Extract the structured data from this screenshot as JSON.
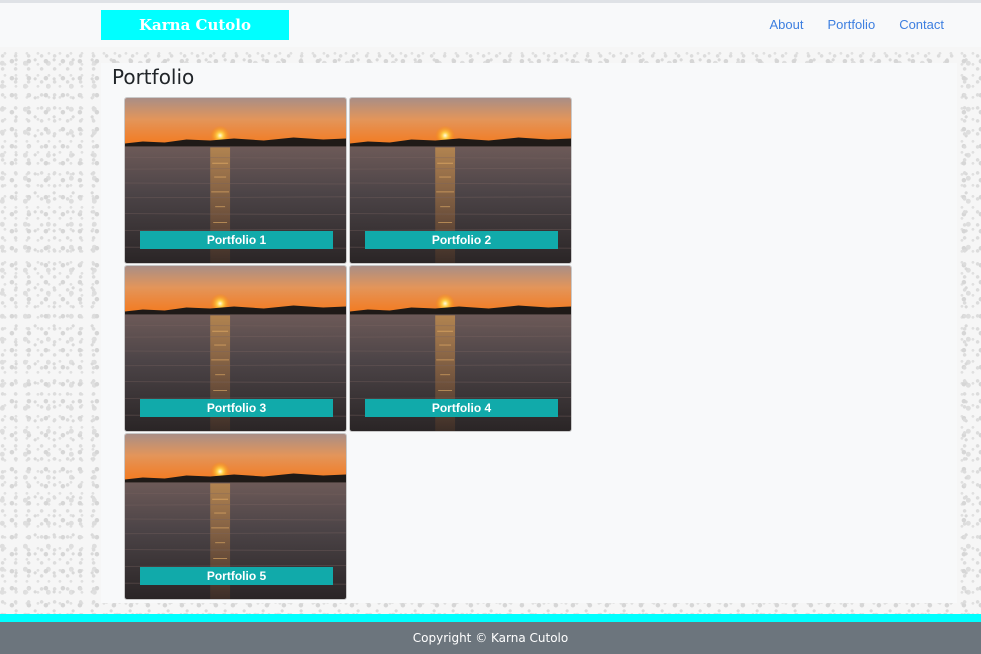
{
  "navbar": {
    "brand": "Karna Cutolo",
    "links": [
      {
        "label": "About"
      },
      {
        "label": "Portfolio"
      },
      {
        "label": "Contact"
      }
    ]
  },
  "main": {
    "title": "Portfolio",
    "cards": [
      {
        "label": "Portfolio 1",
        "image": "sunset-over-water"
      },
      {
        "label": "Portfolio 2",
        "image": "sunset-over-water"
      },
      {
        "label": "Portfolio 3",
        "image": "sunset-over-water"
      },
      {
        "label": "Portfolio 4",
        "image": "sunset-over-water"
      },
      {
        "label": "Portfolio 5",
        "image": "sunset-over-water"
      }
    ]
  },
  "footer": {
    "text": "Copyright © Karna Cutolo"
  },
  "colors": {
    "brand_bg": "#00ffff",
    "link": "#3d7fe0",
    "label_bg": "#11aaaa",
    "footer_bg": "#6c757d"
  }
}
